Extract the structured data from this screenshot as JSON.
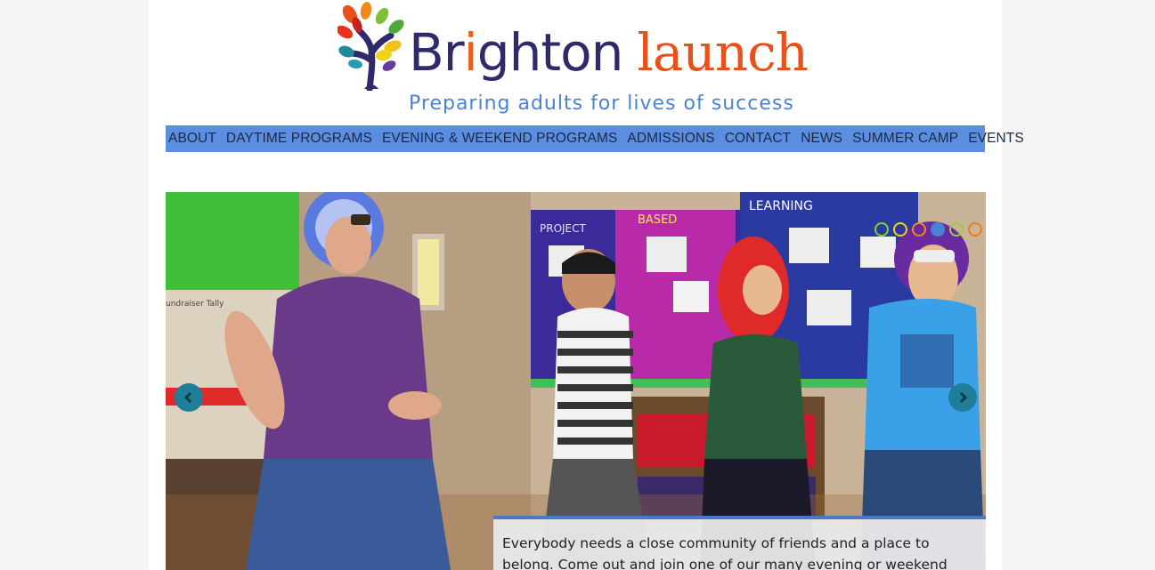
{
  "header": {
    "brand_word1_pre": "Br",
    "brand_word1_i": "i",
    "brand_word1_post": "ghton",
    "brand_word2": "launch",
    "tagline": "Preparing adults for lives of success",
    "brand_colors": {
      "navy": "#2e2a6b",
      "orange": "#e8501c",
      "blue": "#4a82d6"
    }
  },
  "nav": {
    "items": [
      {
        "label": "ABOUT"
      },
      {
        "label": "DAYTIME PROGRAMS"
      },
      {
        "label": "EVENING & WEEKEND PROGRAMS"
      },
      {
        "label": "ADMISSIONS"
      },
      {
        "label": "CONTACT"
      },
      {
        "label": "NEWS"
      },
      {
        "label": "SUMMER CAMP"
      },
      {
        "label": "EVENTS"
      }
    ],
    "background": "#5b8ee0"
  },
  "slider": {
    "photo_text": {
      "project": "PROJECT",
      "based": "BASED",
      "learning": "LEARNING",
      "tally": "undraiser Tally"
    },
    "dots": [
      {
        "color": "#7fcf3a",
        "active": false
      },
      {
        "color": "#f2d21c",
        "active": false
      },
      {
        "color": "#f08a1c",
        "active": false
      },
      {
        "color": "#4a82d6",
        "active": true
      },
      {
        "color": "#9ccf3a",
        "active": false
      },
      {
        "color": "#f07a1c",
        "active": false
      }
    ],
    "prev_icon": "chevron-left-icon",
    "next_icon": "chevron-right-icon",
    "caption": "Everybody needs a close community of friends and a place to belong. Come out and join one of our many evening or weekend social"
  }
}
